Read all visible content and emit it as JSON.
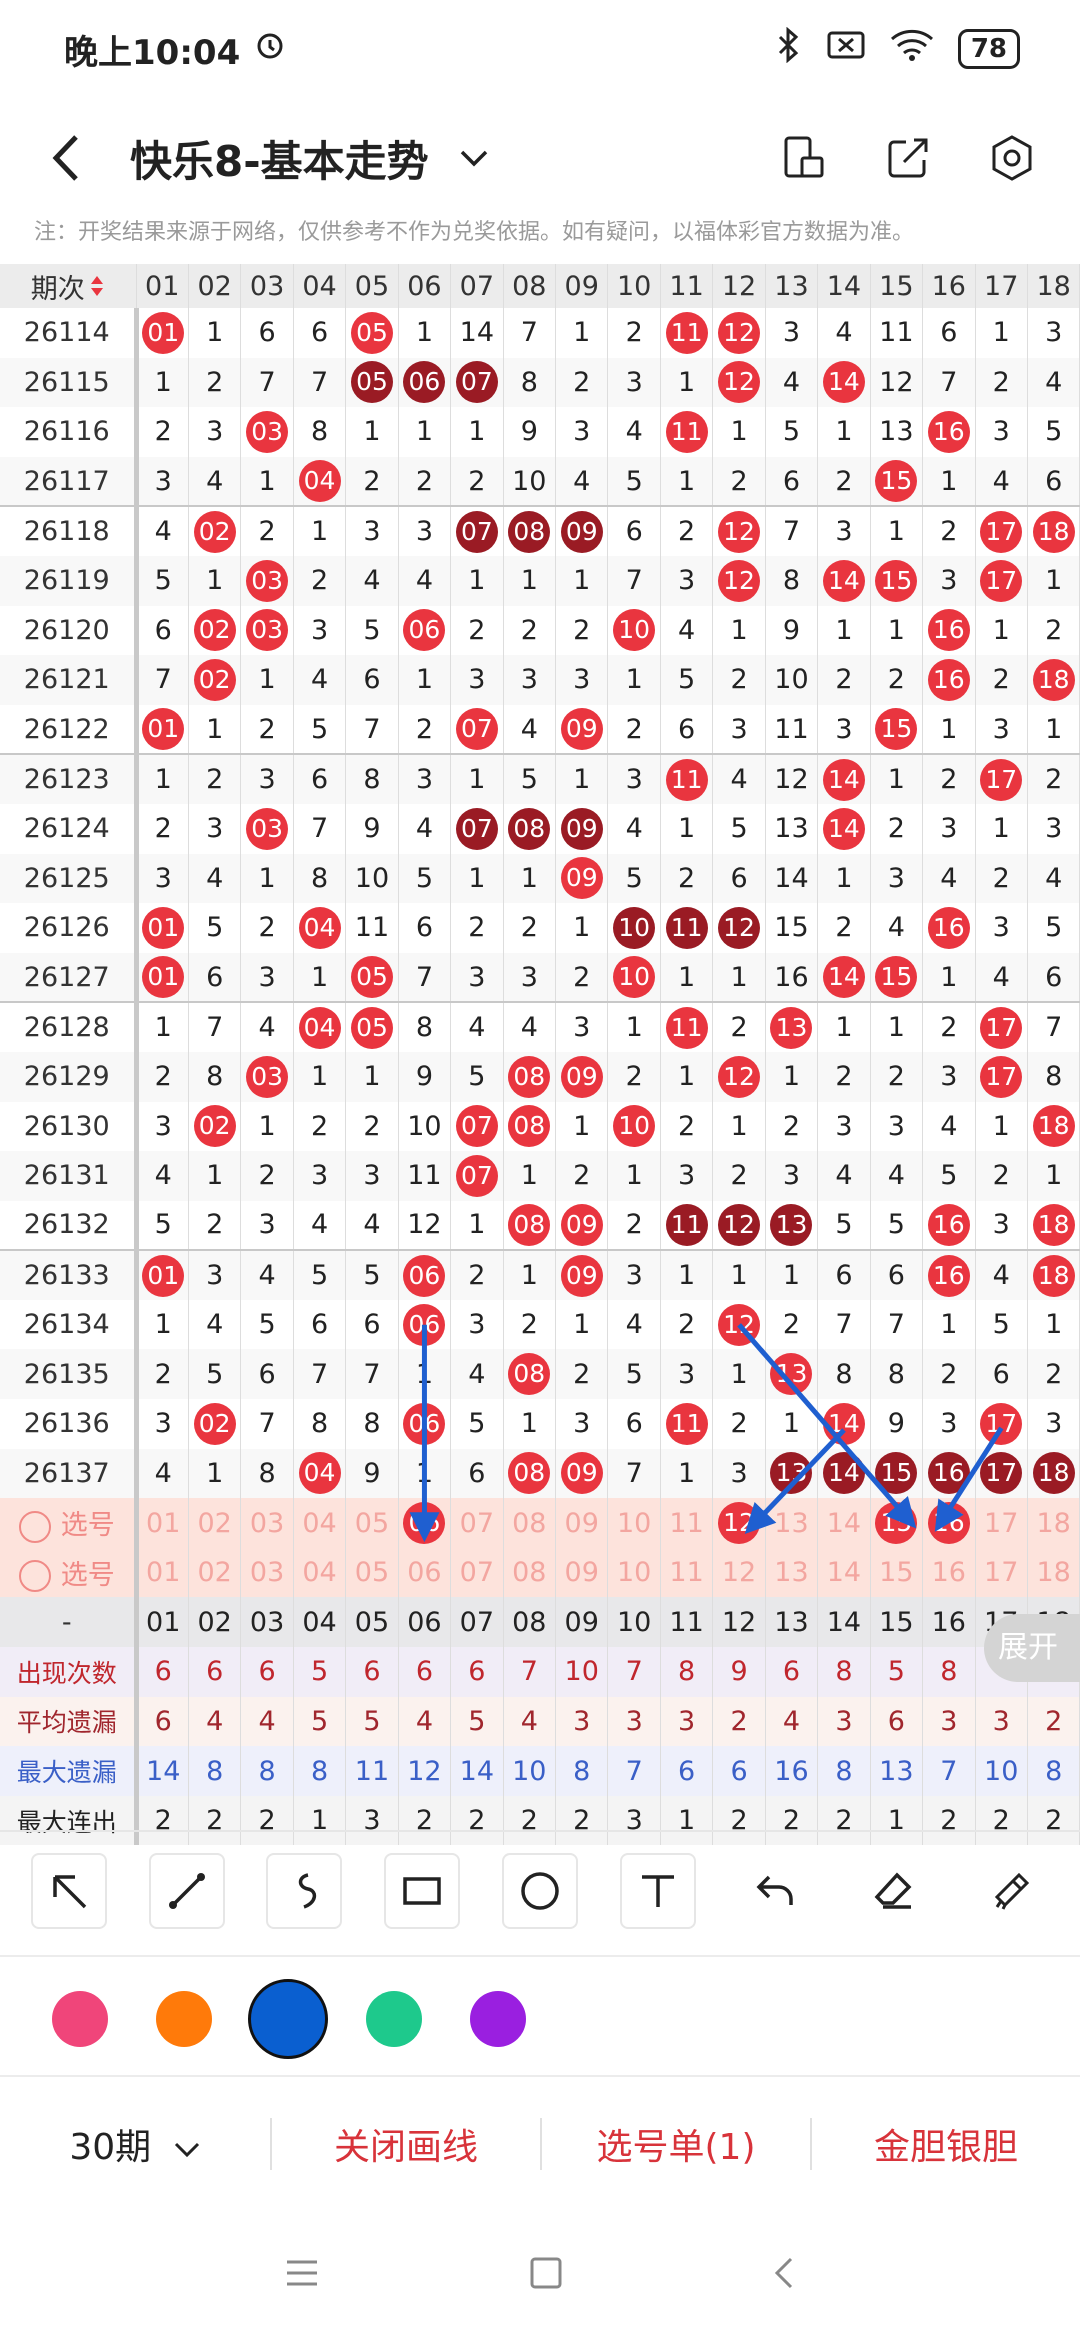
{
  "status": {
    "time": "晚上10:04",
    "battery": "78"
  },
  "header": {
    "title": "快乐8-基本走势"
  },
  "notice": "注：开奖结果来源于网络，仅供参考不作为兑奖依据。如有疑问，以福体彩官方数据为准。",
  "table": {
    "issue_header": "期次",
    "columns": [
      "01",
      "02",
      "03",
      "04",
      "05",
      "06",
      "07",
      "08",
      "09",
      "10",
      "11",
      "12",
      "13",
      "14",
      "15",
      "16",
      "17",
      "18"
    ],
    "rows": [
      {
        "issue": "26114",
        "cells": [
          "01",
          "1",
          "6",
          "6",
          "05",
          "1",
          "14",
          "7",
          "1",
          "2",
          "11",
          "12",
          "3",
          "4",
          "11",
          "6",
          "1",
          "3"
        ],
        "hits": [
          0,
          4,
          10,
          11
        ]
      },
      {
        "issue": "26115",
        "cells": [
          "1",
          "2",
          "7",
          "7",
          "05",
          "06",
          "07",
          "8",
          "2",
          "3",
          "1",
          "12",
          "4",
          "14",
          "12",
          "7",
          "2",
          "4"
        ],
        "hits": [
          11,
          13
        ],
        "dark": [
          4,
          5,
          6
        ]
      },
      {
        "issue": "26116",
        "cells": [
          "2",
          "3",
          "03",
          "8",
          "1",
          "1",
          "1",
          "9",
          "3",
          "4",
          "11",
          "1",
          "5",
          "1",
          "13",
          "16",
          "3",
          "5"
        ],
        "hits": [
          2,
          10,
          15
        ]
      },
      {
        "issue": "26117",
        "cells": [
          "3",
          "4",
          "1",
          "04",
          "2",
          "2",
          "2",
          "10",
          "4",
          "5",
          "1",
          "2",
          "6",
          "2",
          "15",
          "1",
          "4",
          "6"
        ],
        "hits": [
          3,
          14
        ]
      },
      {
        "issue": "26118",
        "cells": [
          "4",
          "02",
          "2",
          "1",
          "3",
          "3",
          "07",
          "08",
          "09",
          "6",
          "2",
          "12",
          "7",
          "3",
          "1",
          "2",
          "17",
          "18"
        ],
        "hits": [
          1,
          11,
          16,
          17
        ],
        "dark": [
          6,
          7,
          8
        ]
      },
      {
        "issue": "26119",
        "cells": [
          "5",
          "1",
          "03",
          "2",
          "4",
          "4",
          "1",
          "1",
          "1",
          "7",
          "3",
          "12",
          "8",
          "14",
          "15",
          "3",
          "17",
          "1"
        ],
        "hits": [
          2,
          11,
          13,
          14,
          16
        ]
      },
      {
        "issue": "26120",
        "cells": [
          "6",
          "02",
          "03",
          "3",
          "5",
          "06",
          "2",
          "2",
          "2",
          "10",
          "4",
          "1",
          "9",
          "1",
          "1",
          "16",
          "1",
          "2"
        ],
        "hits": [
          1,
          2,
          5,
          9,
          15
        ]
      },
      {
        "issue": "26121",
        "cells": [
          "7",
          "02",
          "1",
          "4",
          "6",
          "1",
          "3",
          "3",
          "3",
          "1",
          "5",
          "2",
          "10",
          "2",
          "2",
          "16",
          "2",
          "18"
        ],
        "hits": [
          1,
          15,
          17
        ]
      },
      {
        "issue": "26122",
        "cells": [
          "01",
          "1",
          "2",
          "5",
          "7",
          "2",
          "07",
          "4",
          "09",
          "2",
          "6",
          "3",
          "11",
          "3",
          "15",
          "1",
          "3",
          "1"
        ],
        "hits": [
          0,
          6,
          8,
          14
        ]
      },
      {
        "issue": "26123",
        "cells": [
          "1",
          "2",
          "3",
          "6",
          "8",
          "3",
          "1",
          "5",
          "1",
          "3",
          "11",
          "4",
          "12",
          "14",
          "1",
          "2",
          "17",
          "2"
        ],
        "hits": [
          10,
          13,
          16
        ]
      },
      {
        "issue": "26124",
        "cells": [
          "2",
          "3",
          "03",
          "7",
          "9",
          "4",
          "07",
          "08",
          "09",
          "4",
          "1",
          "5",
          "13",
          "14",
          "2",
          "3",
          "1",
          "3"
        ],
        "hits": [
          2,
          13
        ],
        "dark": [
          6,
          7,
          8
        ]
      },
      {
        "issue": "26125",
        "cells": [
          "3",
          "4",
          "1",
          "8",
          "10",
          "5",
          "1",
          "1",
          "09",
          "5",
          "2",
          "6",
          "14",
          "1",
          "3",
          "4",
          "2",
          "4"
        ],
        "hits": [
          8
        ]
      },
      {
        "issue": "26126",
        "cells": [
          "01",
          "5",
          "2",
          "04",
          "11",
          "6",
          "2",
          "2",
          "1",
          "10",
          "11",
          "12",
          "15",
          "2",
          "4",
          "16",
          "3",
          "5"
        ],
        "hits": [
          0,
          3,
          15
        ],
        "dark": [
          9,
          10,
          11
        ]
      },
      {
        "issue": "26127",
        "cells": [
          "01",
          "6",
          "3",
          "1",
          "05",
          "7",
          "3",
          "3",
          "2",
          "10",
          "1",
          "1",
          "16",
          "14",
          "15",
          "1",
          "4",
          "6"
        ],
        "hits": [
          0,
          4,
          9,
          13,
          14
        ]
      },
      {
        "issue": "26128",
        "cells": [
          "1",
          "7",
          "4",
          "04",
          "05",
          "8",
          "4",
          "4",
          "3",
          "1",
          "11",
          "2",
          "13",
          "1",
          "1",
          "2",
          "17",
          "7"
        ],
        "hits": [
          3,
          4,
          10,
          12,
          16
        ]
      },
      {
        "issue": "26129",
        "cells": [
          "2",
          "8",
          "03",
          "1",
          "1",
          "9",
          "5",
          "08",
          "09",
          "2",
          "1",
          "12",
          "1",
          "2",
          "2",
          "3",
          "17",
          "8"
        ],
        "hits": [
          2,
          7,
          8,
          11,
          16
        ]
      },
      {
        "issue": "26130",
        "cells": [
          "3",
          "02",
          "1",
          "2",
          "2",
          "10",
          "07",
          "08",
          "1",
          "10",
          "2",
          "1",
          "2",
          "3",
          "3",
          "4",
          "1",
          "18"
        ],
        "hits": [
          1,
          6,
          7,
          9,
          17
        ]
      },
      {
        "issue": "26131",
        "cells": [
          "4",
          "1",
          "2",
          "3",
          "3",
          "11",
          "07",
          "1",
          "2",
          "1",
          "3",
          "2",
          "3",
          "4",
          "4",
          "5",
          "2",
          "1"
        ],
        "hits": [
          6
        ]
      },
      {
        "issue": "26132",
        "cells": [
          "5",
          "2",
          "3",
          "4",
          "4",
          "12",
          "1",
          "08",
          "09",
          "2",
          "11",
          "12",
          "13",
          "5",
          "5",
          "16",
          "3",
          "18"
        ],
        "hits": [
          7,
          8,
          15,
          17
        ],
        "dark": [
          10,
          11,
          12
        ]
      },
      {
        "issue": "26133",
        "cells": [
          "01",
          "3",
          "4",
          "5",
          "5",
          "06",
          "2",
          "1",
          "09",
          "3",
          "1",
          "1",
          "1",
          "6",
          "6",
          "16",
          "4",
          "18"
        ],
        "hits": [
          0,
          5,
          8,
          15,
          17
        ]
      },
      {
        "issue": "26134",
        "cells": [
          "1",
          "4",
          "5",
          "6",
          "6",
          "06",
          "3",
          "2",
          "1",
          "4",
          "2",
          "12",
          "2",
          "7",
          "7",
          "1",
          "5",
          "1"
        ],
        "hits": [
          5,
          11
        ]
      },
      {
        "issue": "26135",
        "cells": [
          "2",
          "5",
          "6",
          "7",
          "7",
          "1",
          "4",
          "08",
          "2",
          "5",
          "3",
          "1",
          "13",
          "8",
          "8",
          "2",
          "6",
          "2"
        ],
        "hits": [
          7,
          12
        ]
      },
      {
        "issue": "26136",
        "cells": [
          "3",
          "02",
          "7",
          "8",
          "8",
          "06",
          "5",
          "1",
          "3",
          "6",
          "11",
          "2",
          "1",
          "14",
          "9",
          "3",
          "17",
          "3"
        ],
        "hits": [
          1,
          5,
          10,
          13,
          16
        ]
      },
      {
        "issue": "26137",
        "cells": [
          "4",
          "1",
          "8",
          "04",
          "9",
          "1",
          "6",
          "08",
          "09",
          "7",
          "1",
          "3",
          "13",
          "14",
          "15",
          "16",
          "17",
          "18"
        ],
        "hits": [
          3,
          7,
          8
        ],
        "dark": [
          12,
          13,
          14,
          15,
          16,
          17
        ]
      }
    ],
    "select_rows": [
      {
        "label": "选号",
        "cells": [
          "01",
          "02",
          "03",
          "04",
          "05",
          "06",
          "07",
          "08",
          "09",
          "10",
          "11",
          "12",
          "13",
          "14",
          "15",
          "16",
          "17",
          "18"
        ],
        "hits": [
          5,
          11,
          14,
          15
        ]
      },
      {
        "label": "选号",
        "cells": [
          "01",
          "02",
          "03",
          "04",
          "05",
          "06",
          "07",
          "08",
          "09",
          "10",
          "11",
          "12",
          "13",
          "14",
          "15",
          "16",
          "17",
          "18"
        ],
        "hits": []
      }
    ],
    "stat_header": {
      "label": "-",
      "cells": [
        "01",
        "02",
        "03",
        "04",
        "05",
        "06",
        "07",
        "08",
        "09",
        "10",
        "11",
        "12",
        "13",
        "14",
        "15",
        "16",
        "17",
        "18"
      ]
    },
    "stats": [
      {
        "label": "出现次数",
        "cells": [
          "6",
          "6",
          "6",
          "5",
          "6",
          "6",
          "6",
          "7",
          "10",
          "7",
          "8",
          "9",
          "6",
          "8",
          "5",
          "8",
          "",
          ""
        ]
      },
      {
        "label": "平均遗漏",
        "cells": [
          "6",
          "4",
          "4",
          "5",
          "5",
          "4",
          "5",
          "4",
          "3",
          "3",
          "3",
          "2",
          "4",
          "3",
          "6",
          "3",
          "3",
          "2"
        ]
      },
      {
        "label": "最大遗漏",
        "cells": [
          "14",
          "8",
          "8",
          "8",
          "11",
          "12",
          "14",
          "10",
          "8",
          "7",
          "6",
          "6",
          "16",
          "8",
          "13",
          "7",
          "10",
          "8"
        ]
      },
      {
        "label": "最大连出",
        "cells": [
          "2",
          "2",
          "2",
          "1",
          "3",
          "2",
          "2",
          "2",
          "2",
          "3",
          "1",
          "2",
          "2",
          "2",
          "1",
          "2",
          "2",
          "2"
        ]
      }
    ]
  },
  "expand_label": "展开",
  "tools": [
    "arrow-tool",
    "line-tool",
    "curve-tool",
    "rectangle-tool",
    "circle-tool",
    "text-tool",
    "undo-tool",
    "eraser-tool",
    "clear-tool"
  ],
  "colors": [
    "#f0457a",
    "#ff7a0a",
    "#0a5fd0",
    "#1ec98c",
    "#9a1fe0"
  ],
  "selected_color": "#0a5fd0",
  "bottom": {
    "period": "30期",
    "close_draw": "关闭画线",
    "selection": "选号单(1)",
    "golden": "金胆银胆"
  }
}
